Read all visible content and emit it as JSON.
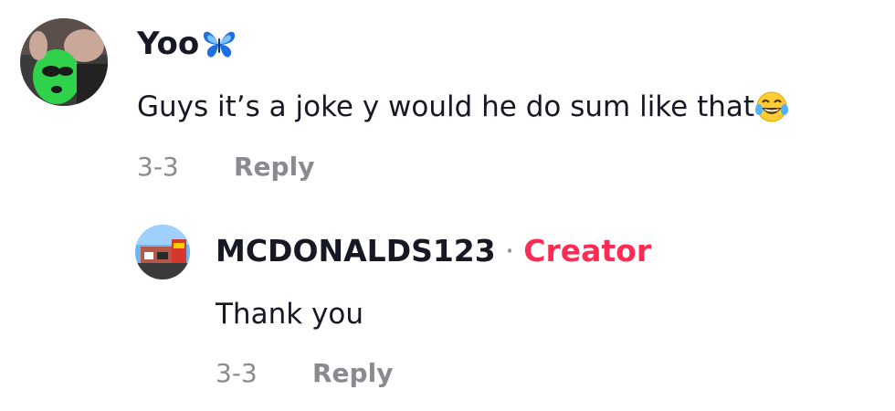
{
  "comments": [
    {
      "username": "Yoo",
      "username_emoji": "butterfly-emoji",
      "text": "Guys it’s a joke y would he do sum like that",
      "text_emoji": "tears-of-joy-emoji",
      "date": "3-3",
      "reply_label": "Reply"
    }
  ],
  "replies": [
    {
      "username": "MCDONALDS123",
      "separator": "·",
      "badge": "Creator",
      "text": "Thank you",
      "date": "3-3",
      "reply_label": "Reply"
    }
  ],
  "colors": {
    "text_primary": "#161823",
    "text_secondary": "#8a8b91",
    "creator_badge": "#fe2c55"
  }
}
